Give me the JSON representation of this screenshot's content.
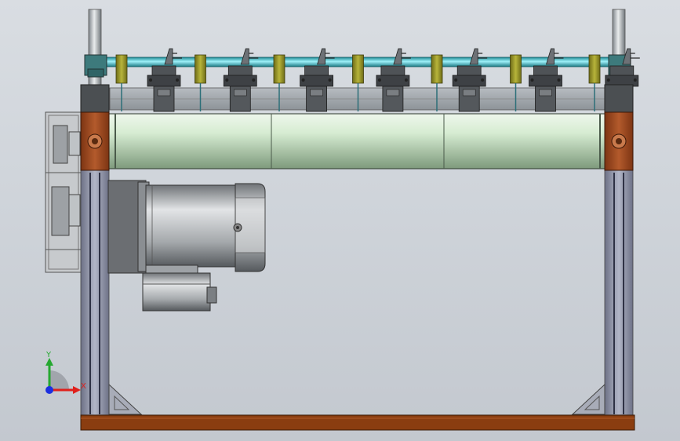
{
  "viewport": {
    "background_top": "#d9dde2",
    "background_bottom": "#c3c8cf"
  },
  "colors": {
    "shaft": "#3cc6d6",
    "roller": "#c9e6c7",
    "bearing_block": "#9b4a22",
    "frame": "#8e93a6",
    "base_plate": "#8a3d10",
    "guide_block": "#8c8a25",
    "motor_body": "#9fa3a6"
  },
  "assembly": {
    "cutter_count": 7,
    "guide_block_count": 7,
    "roller_segments": 3
  },
  "triad": {
    "x_label": "X",
    "y_label": "Y",
    "x_color": "#e0201c",
    "y_color": "#25a830",
    "z_color": "#1c2fe0"
  }
}
